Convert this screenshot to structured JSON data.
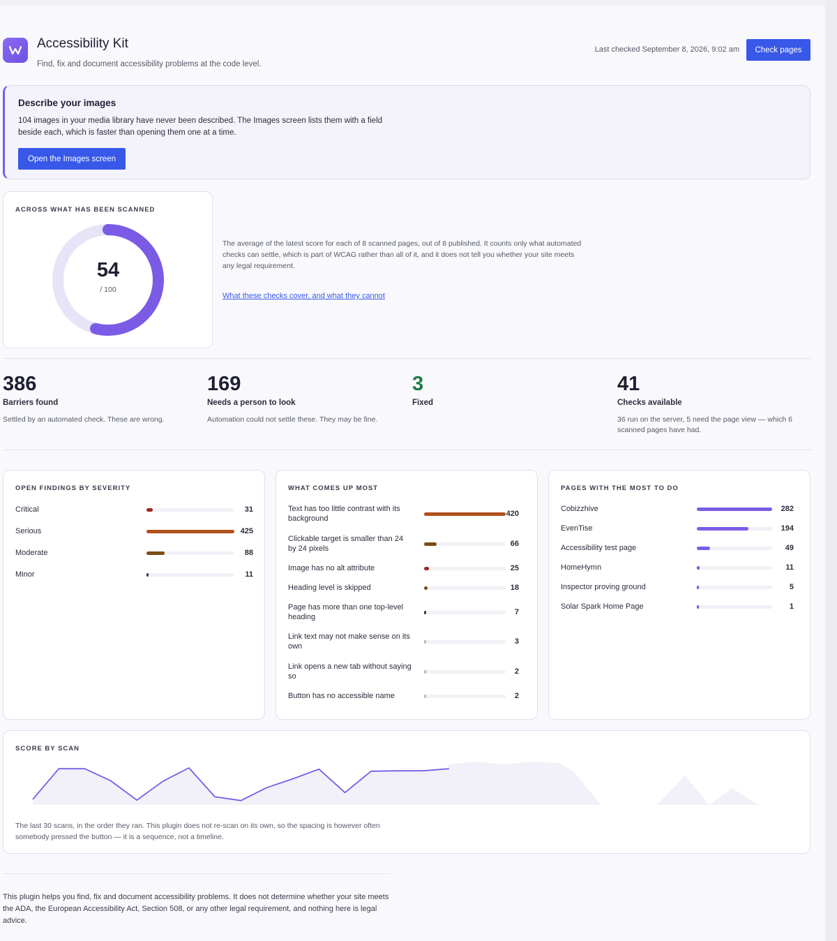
{
  "header": {
    "title": "Accessibility Kit",
    "subtitle": "Find, fix and document accessibility problems at the code level.",
    "last_checked": "Last checked September 8, 2026, 9:02 am",
    "check_button": "Check pages",
    "logo_icon": "w-logo-icon"
  },
  "notice": {
    "title": "Describe your images",
    "body": "104 images in your media library have never been described. The Images screen lists them with a field beside each, which is faster than opening them one at a time.",
    "button": "Open the Images screen"
  },
  "score": {
    "label": "ACROSS WHAT HAS BEEN SCANNED",
    "value": "54",
    "max": "/ 100",
    "fraction": 0.54,
    "description": "The average of the latest score for each of 8 scanned pages, out of 8 published. It counts only what automated checks can settle, which is part of WCAG rather than all of it, and it does not tell you whether your site meets any legal requirement.",
    "link": "What these checks cover, and what they cannot"
  },
  "stats": [
    {
      "value": "386",
      "label": "Barriers found",
      "desc": "Settled by an automated check. These are wrong."
    },
    {
      "value": "169",
      "label": "Needs a person to look",
      "desc": "Automation could not settle these. They may be fine."
    },
    {
      "value": "3",
      "label": "Fixed",
      "desc": ""
    },
    {
      "value": "41",
      "label": "Checks available",
      "desc": "36 run on the server, 5 need the page view — which 6 scanned pages have had."
    }
  ],
  "severity": {
    "label": "OPEN FINDINGS BY SEVERITY",
    "max": 425,
    "items": [
      {
        "label": "Critical",
        "value": 31,
        "color": "#a1261f"
      },
      {
        "label": "Serious",
        "value": 425,
        "color": "#b0501a"
      },
      {
        "label": "Moderate",
        "value": 88,
        "color": "#7a4d14"
      },
      {
        "label": "Minor",
        "value": 11,
        "color": "#3c3c4a"
      }
    ]
  },
  "common": {
    "label": "WHAT COMES UP MOST",
    "max": 420,
    "items": [
      {
        "label": "Text has too little contrast with its background",
        "value": 420,
        "color": "#b0501a"
      },
      {
        "label": "Clickable target is smaller than 24 by 24 pixels",
        "value": 66,
        "color": "#7a4d14"
      },
      {
        "label": "Image has no alt attribute",
        "value": 25,
        "color": "#a1261f"
      },
      {
        "label": "Heading level is skipped",
        "value": 18,
        "color": "#7a4d14"
      },
      {
        "label": "Page has more than one top-level heading",
        "value": 7,
        "color": "#3c3c4a"
      },
      {
        "label": "Link text may not make sense on its own",
        "value": 3,
        "color": "#b8b8c8"
      },
      {
        "label": "Link opens a new tab without saying so",
        "value": 2,
        "color": "#b8b8c8"
      },
      {
        "label": "Button has no accessible name",
        "value": 2,
        "color": "#b8b8c8"
      }
    ]
  },
  "pages": {
    "label": "PAGES WITH THE MOST TO DO",
    "max": 282,
    "color": "#7b5be6",
    "items": [
      {
        "label": "Cobizzhive",
        "value": 282
      },
      {
        "label": "EvenTise",
        "value": 194
      },
      {
        "label": "Accessibility test page",
        "value": 49
      },
      {
        "label": "HomeHymn",
        "value": 11
      },
      {
        "label": "Inspector proving ground",
        "value": 5
      },
      {
        "label": "Solar Spark Home Page",
        "value": 1
      }
    ]
  },
  "scan": {
    "label": "SCORE BY SCAN",
    "description": "The last 30 scans, in the order they ran. This plugin does not re-scan on its own, so the spacing is however often somebody pressed the button — it is a sequence, not a timeline.",
    "line_color": "#7b5be6"
  },
  "chart_data": {
    "type": "line",
    "title": "SCORE BY SCAN",
    "xlabel": "",
    "ylabel": "",
    "ylim": [
      0,
      100
    ],
    "x": [
      1,
      2,
      3,
      4,
      5,
      6,
      7,
      8,
      9,
      10,
      11,
      12,
      13,
      14,
      15,
      16,
      17
    ],
    "series": [
      {
        "values": [
          10,
          83,
          83,
          54,
          8,
          53,
          85,
          16,
          7,
          38,
          59,
          82,
          26,
          77,
          78,
          78,
          83
        ]
      }
    ]
  },
  "footer": {
    "text": "This plugin helps you find, fix and document accessibility problems. It does not determine whether your site meets the ADA, the European Accessibility Act, Section 508, or any other legal requirement, and nothing here is legal advice."
  }
}
